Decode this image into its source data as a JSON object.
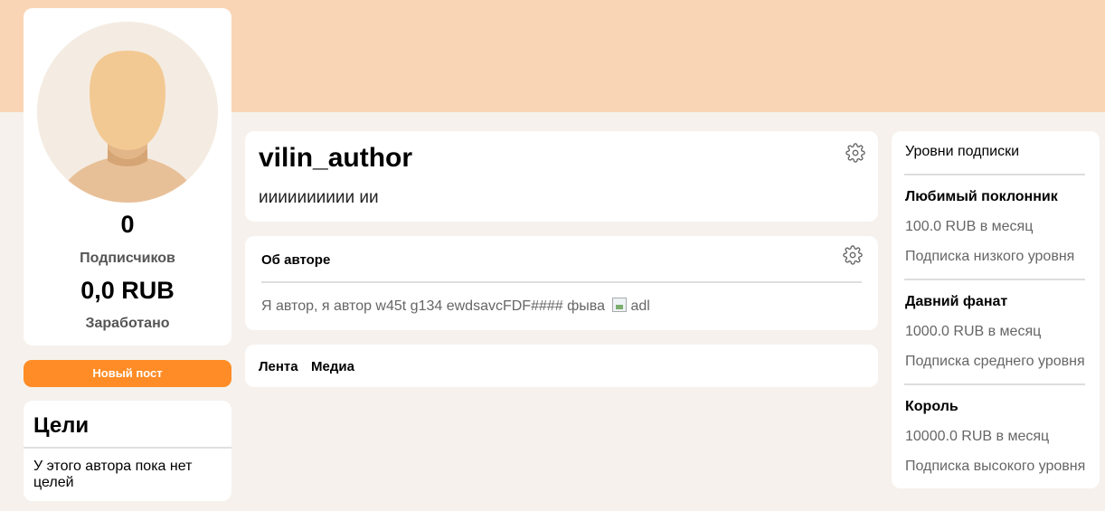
{
  "profile": {
    "subscribers_count": "0",
    "subscribers_label": "Подписчиков",
    "earned_amount": "0,0 RUB",
    "earned_label": "Заработано"
  },
  "actions": {
    "new_post_label": "Новый пост"
  },
  "goals": {
    "title": "Цели",
    "empty_text": "У этого автора пока нет целей"
  },
  "author": {
    "name": "vilin_author",
    "tagline": "ииииииииии ии"
  },
  "about": {
    "title": "Об авторе",
    "text": "Я автор, я автор w45t g134 ewdsavcFDF#### фыва",
    "image_alt": "adl"
  },
  "tabs": [
    {
      "label": "Лента"
    },
    {
      "label": "Медиа"
    }
  ],
  "subscription_tiers": {
    "title": "Уровни подписки",
    "tiers": [
      {
        "name": "Любимый поклонник",
        "price": "100.0 RUB в месяц",
        "description": "Подписка низкого уровня"
      },
      {
        "name": "Давний фанат",
        "price": "1000.0 RUB в месяц",
        "description": "Подписка среднего уровня"
      },
      {
        "name": "Король",
        "price": "10000.0 RUB в месяц",
        "description": "Подписка высокого уровня"
      }
    ]
  },
  "colors": {
    "banner": "#f9d5b6",
    "page_background": "#f6f1ec",
    "accent_button": "#ff8c26"
  },
  "icons": {
    "settings": "gear-icon",
    "avatar": "user-silhouette"
  }
}
